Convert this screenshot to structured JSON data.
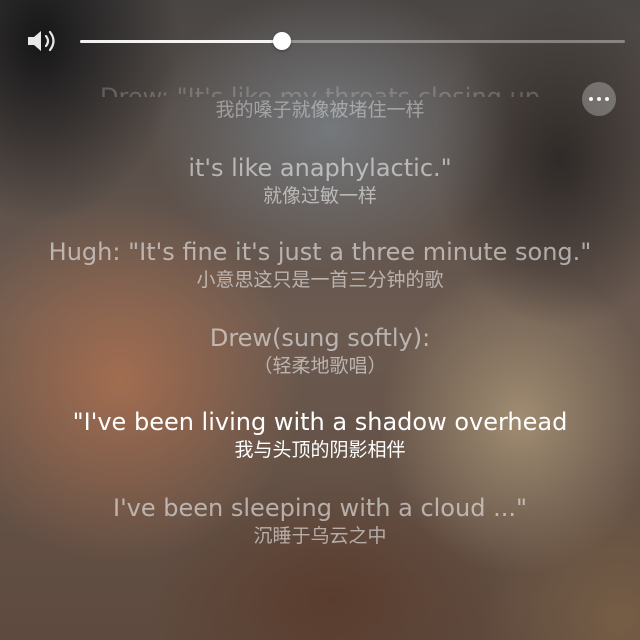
{
  "volume": {
    "level": 0.37,
    "icon": "speaker-volume-icon"
  },
  "more_button": {
    "icon": "more-ellipsis-icon"
  },
  "lyrics": [
    {
      "en": "Drew: \"It's like my throats closing up",
      "zh": "我的嗓子就像被堵住一样",
      "state": "faded"
    },
    {
      "en": "it's like anaphylactic.\"",
      "zh": "就像过敏一样",
      "state": "normal"
    },
    {
      "en": "Hugh: \"It's fine it's just a three minute song.\"",
      "zh": "小意思这只是一首三分钟的歌",
      "state": "normal"
    },
    {
      "en": "Drew(sung softly):",
      "zh": "（轻柔地歌唱）",
      "state": "normal"
    },
    {
      "en": "\"I've been living with a shadow overhead",
      "zh": "我与头顶的阴影相伴",
      "state": "active"
    },
    {
      "en": "I've been sleeping with a cloud ...\"",
      "zh": "沉睡于乌云之中",
      "state": "normal"
    }
  ]
}
